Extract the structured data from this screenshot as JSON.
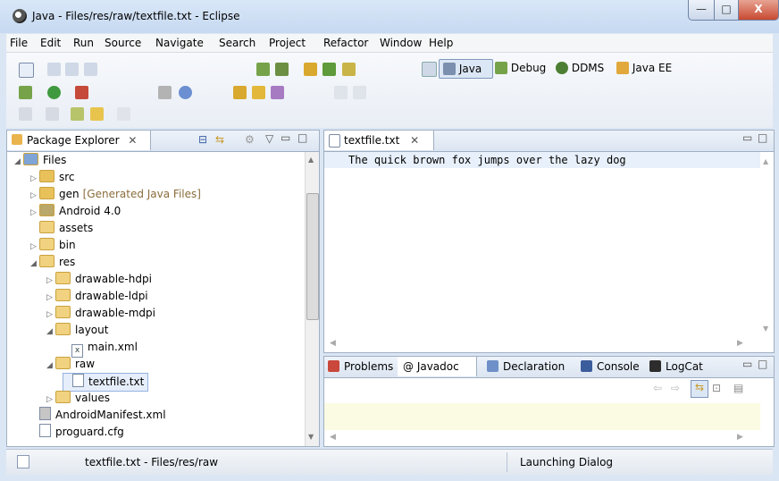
{
  "window": {
    "title": "Java - Files/res/raw/textfile.txt - Eclipse",
    "min_label": "—",
    "max_label": "□",
    "close_label": "X"
  },
  "menu": [
    "File",
    "Edit",
    "Run",
    "Source",
    "Navigate",
    "Search",
    "Project",
    "Refactor",
    "Window",
    "Help"
  ],
  "perspectives": [
    "Java",
    "Debug",
    "DDMS",
    "Java EE"
  ],
  "package_explorer": {
    "tab_label": "Package Explorer",
    "tree": [
      {
        "label": "Files",
        "level": 0,
        "arrow": "◢",
        "icon": "project"
      },
      {
        "label": "src",
        "level": 1,
        "arrow": "▷",
        "icon": "pkg"
      },
      {
        "label": "gen",
        "suffix": "[Generated Java Files]",
        "level": 1,
        "arrow": "▷",
        "icon": "pkg"
      },
      {
        "label": "Android 4.0",
        "level": 1,
        "arrow": "▷",
        "icon": "lib"
      },
      {
        "label": "assets",
        "level": 1,
        "arrow": "",
        "icon": "folder"
      },
      {
        "label": "bin",
        "level": 1,
        "arrow": "▷",
        "icon": "folder"
      },
      {
        "label": "res",
        "level": 1,
        "arrow": "◢",
        "icon": "folder"
      },
      {
        "label": "drawable-hdpi",
        "level": 2,
        "arrow": "▷",
        "icon": "folder"
      },
      {
        "label": "drawable-ldpi",
        "level": 2,
        "arrow": "▷",
        "icon": "folder"
      },
      {
        "label": "drawable-mdpi",
        "level": 2,
        "arrow": "▷",
        "icon": "folder"
      },
      {
        "label": "layout",
        "level": 2,
        "arrow": "◢",
        "icon": "folder"
      },
      {
        "label": "main.xml",
        "level": 3,
        "arrow": "",
        "icon": "xml"
      },
      {
        "label": "raw",
        "level": 2,
        "arrow": "◢",
        "icon": "folder"
      },
      {
        "label": "textfile.txt",
        "level": 3,
        "arrow": "",
        "icon": "file",
        "selected": true
      },
      {
        "label": "values",
        "level": 2,
        "arrow": "▷",
        "icon": "folder"
      },
      {
        "label": "AndroidManifest.xml",
        "level": 1,
        "arrow": "",
        "icon": "manifest"
      },
      {
        "label": "proguard.cfg",
        "level": 1,
        "arrow": "",
        "icon": "file"
      }
    ]
  },
  "editor": {
    "tab_label": "textfile.txt",
    "content": "The quick brown fox jumps over the lazy dog"
  },
  "bottom_panel": {
    "tabs": [
      "Problems",
      "@ Javadoc",
      "Declaration",
      "Console",
      "LogCat"
    ]
  },
  "status": {
    "left": "textfile.txt - Files/res/raw",
    "right": "Launching Dialog"
  }
}
